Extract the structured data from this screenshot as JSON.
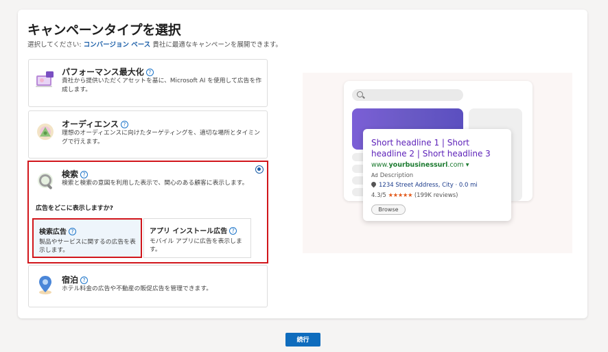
{
  "header": {
    "title": "キャンペーンタイプを選択",
    "subtitle_prefix": "選択してください: ",
    "subtitle_link": "コンバージョン ベース",
    "subtitle_suffix": " 貴社に最適なキャンペーンを展開できます。"
  },
  "options": [
    {
      "id": "performance",
      "name": "パフォーマンス最大化",
      "desc": "貴社から提供いただくアセットを基に、Microsoft AI を使用して広告を作成します。",
      "icon": "performance-max-icon"
    },
    {
      "id": "audience",
      "name": "オーディエンス",
      "desc": "理想のオーディエンスに向けたターゲティングを、適切な場所とタイミングで行えます。",
      "icon": "audience-icon"
    },
    {
      "id": "search",
      "name": "検索",
      "desc": "検索と検索の意図を利用した表示で、関心のある顧客に表示します。",
      "icon": "search-icon",
      "selected": true
    },
    {
      "id": "hotel",
      "name": "宿泊",
      "desc": "ホテル料金の広告や不動産の販促広告を管理できます。",
      "icon": "hotel-pin-icon"
    }
  ],
  "search_sub": {
    "question": "広告をどこに表示しますか?",
    "items": [
      {
        "id": "search_ads",
        "name": "検索広告",
        "desc": "製品やサービスに関するの広告を表示します。",
        "selected": true
      },
      {
        "id": "app_install",
        "name": "アプリ インストール広告",
        "desc": "モバイル アプリに広告を表示します。",
        "selected": false
      }
    ]
  },
  "preview": {
    "headline": "Short headline 1 | Short headline 2 | Short headline 3",
    "url_prefix": "www.",
    "url_domain": "yourbusinessurl",
    "url_suffix": ".com",
    "ad_badge": "Ad",
    "description": "Description",
    "address": "1234 Street Address, City · 0.0 mi",
    "rating": "4.3/5",
    "stars": "★★★★★",
    "reviews": "(199K reviews)",
    "browse_label": "Browse"
  },
  "footer": {
    "continue_label": "続行"
  },
  "colors": {
    "accent": "#0f6cbd",
    "highlight": "#d1151a",
    "headline": "#5b1fb8",
    "url": "#1b7a2f"
  }
}
